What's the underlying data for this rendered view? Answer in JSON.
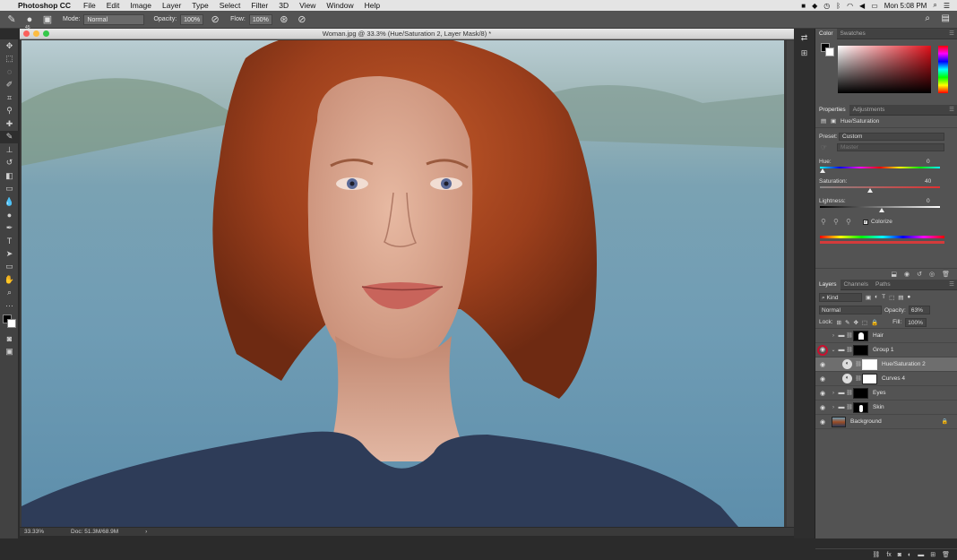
{
  "menubar": {
    "app_name": "Photoshop CC",
    "items": [
      "File",
      "Edit",
      "Image",
      "Layer",
      "Type",
      "Select",
      "Filter",
      "3D",
      "View",
      "Window",
      "Help"
    ],
    "clock": "Mon 5:08 PM"
  },
  "options": {
    "brush_size": "45",
    "mode_label": "Mode:",
    "mode_value": "Normal",
    "opacity_label": "Opacity:",
    "opacity_value": "100%",
    "flow_label": "Flow:",
    "flow_value": "100%"
  },
  "document": {
    "title": "Woman.jpg @ 33.3% (Hue/Saturation 2, Layer Mask/8) *",
    "zoom": "33.33%",
    "doc_size": "Doc: 51.3M/68.9M"
  },
  "color_panel": {
    "tabs": [
      "Color",
      "Swatches"
    ],
    "foreground": "#000000",
    "background": "#ffffff"
  },
  "properties": {
    "tabs": [
      "Properties",
      "Adjustments"
    ],
    "header": "Hue/Saturation",
    "preset_label": "Preset:",
    "preset_value": "Custom",
    "channel_value": "Master",
    "hue_label": "Hue:",
    "hue_value": "0",
    "saturation_label": "Saturation:",
    "saturation_value": "40",
    "lightness_label": "Lightness:",
    "lightness_value": "0",
    "colorize_label": "Colorize",
    "colorize_checked": true
  },
  "layers_panel": {
    "tabs": [
      "Layers",
      "Channels",
      "Paths"
    ],
    "filter_kind": "Kind",
    "blend_mode": "Normal",
    "opacity_label": "Opacity:",
    "opacity_value": "63%",
    "lock_label": "Lock:",
    "fill_label": "Fill:",
    "fill_value": "100%",
    "layers": [
      {
        "name": "Hair",
        "kind": "group"
      },
      {
        "name": "Group 1",
        "kind": "group"
      },
      {
        "name": "Hue/Saturation 2",
        "kind": "adjustment",
        "selected": true
      },
      {
        "name": "Curves 4",
        "kind": "adjustment"
      },
      {
        "name": "Eyes",
        "kind": "group"
      },
      {
        "name": "Skin",
        "kind": "group"
      },
      {
        "name": "Background",
        "kind": "image"
      }
    ]
  }
}
